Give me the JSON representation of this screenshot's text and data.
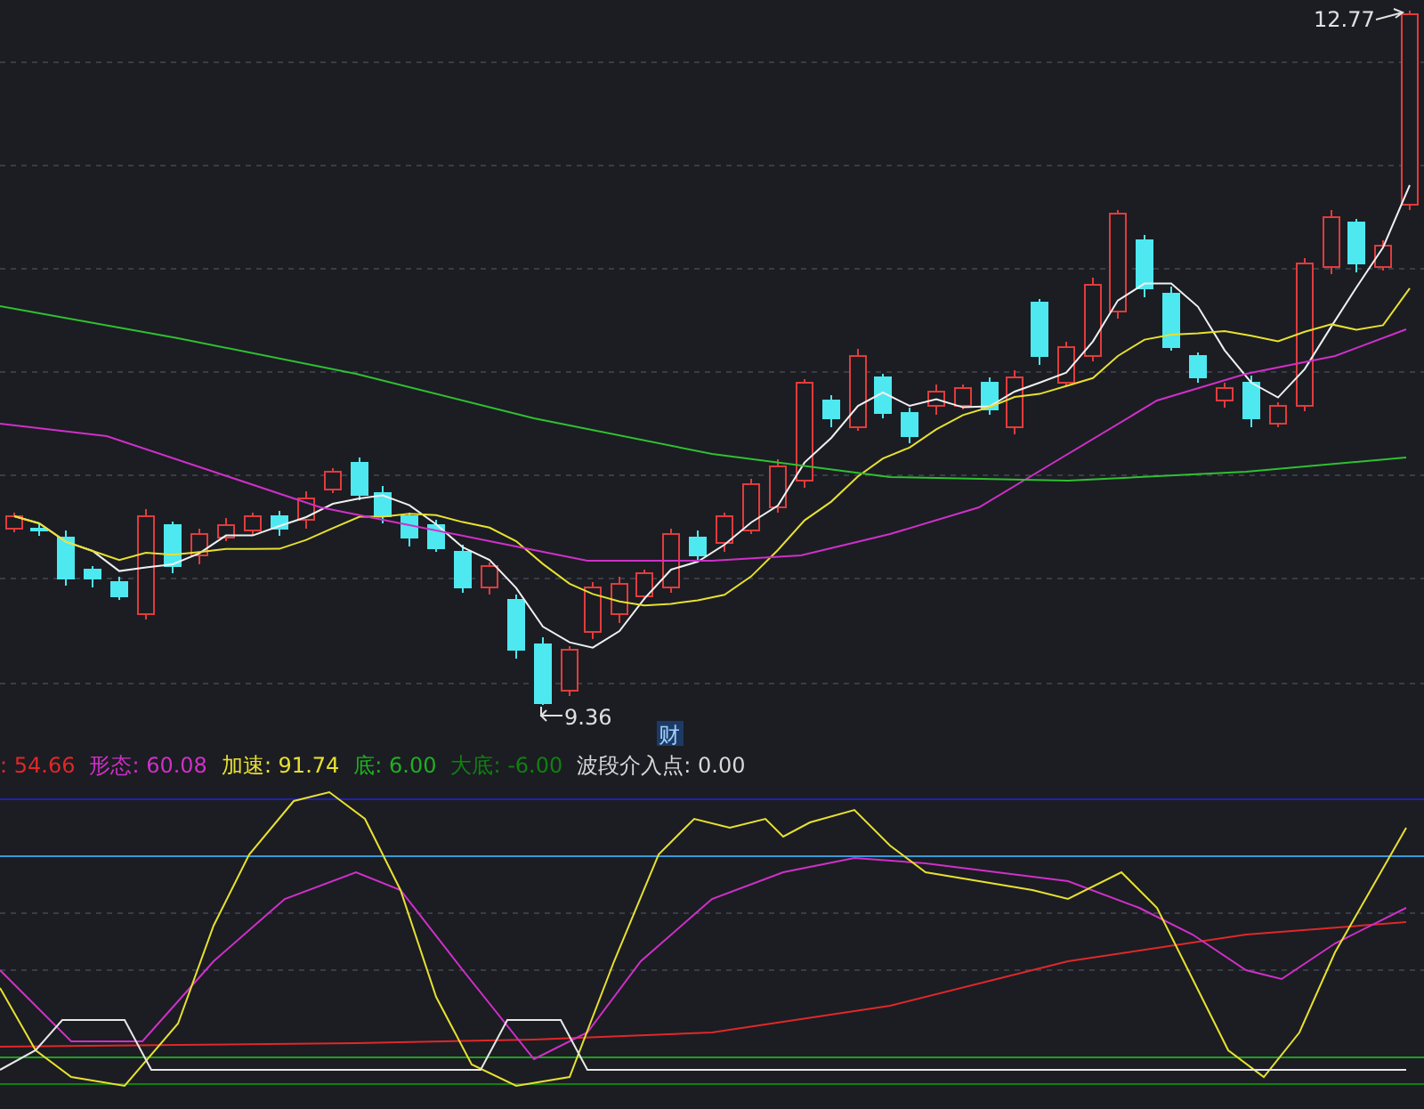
{
  "main_chart": {
    "high_marker": "12.77",
    "low_marker": "9.36",
    "badge": "财"
  },
  "indicator_legend": [
    {
      "text": ": 54.66",
      "color": "#e02828"
    },
    {
      "text": "形态: 60.08",
      "color": "#d030c8"
    },
    {
      "text": "加速: 91.74",
      "color": "#e8e030"
    },
    {
      "text": "底: 6.00",
      "color": "#20b020"
    },
    {
      "text": "大底: -6.00",
      "color": "#108010"
    },
    {
      "text": "波段介入点: 0.00",
      "color": "#d8d8d8"
    }
  ]
}
